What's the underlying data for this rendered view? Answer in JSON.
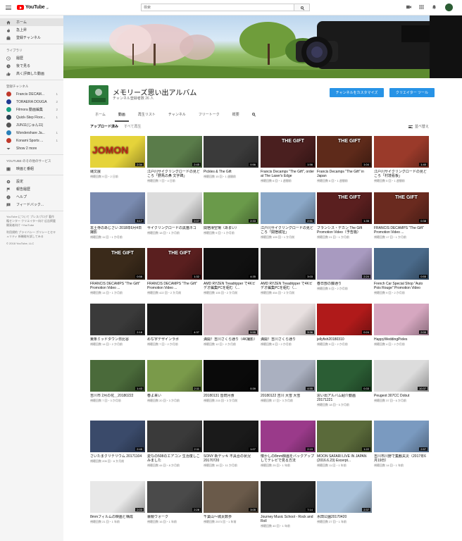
{
  "topbar": {
    "logo_text": "YouTube",
    "logo_region": "JP",
    "search_placeholder": "検索"
  },
  "sidebar": {
    "main": [
      {
        "label": "ホーム",
        "icon": "home-icon"
      },
      {
        "label": "急上昇",
        "icon": "trending-icon"
      },
      {
        "label": "登録チャンネル",
        "icon": "subscriptions-icon"
      }
    ],
    "library_heading": "ライブラリ",
    "library": [
      {
        "label": "履歴",
        "icon": "history-icon"
      },
      {
        "label": "後で見る",
        "icon": "watch-later-icon"
      },
      {
        "label": "高く評価した動画",
        "icon": "thumb-up-icon"
      }
    ],
    "subs_heading": "登録チャンネル",
    "subs": [
      {
        "label": "Francis DECAM...",
        "count": "1",
        "color": "#c0392b"
      },
      {
        "label": "TORAERA DOUGA",
        "count": "2",
        "color": "#1f3a93"
      },
      {
        "label": "Filmora 動画編集",
        "count": "2",
        "color": "#16a085"
      },
      {
        "label": "Quick-Step Floor...",
        "count": "1",
        "color": "#2c3e50"
      },
      {
        "label": "JUN11(じゅん11)",
        "count": "",
        "color": "#555555"
      },
      {
        "label": "Wondershare Ja...",
        "count": "1",
        "color": "#2980b9"
      },
      {
        "label": "Konami Sports ...",
        "count": "1",
        "color": "#c0392b"
      }
    ],
    "show_more": "Show 2 more",
    "services_heading": "YouTube のその他のサービス",
    "services": [
      {
        "label": "映画と番組",
        "icon": "movies-icon"
      }
    ],
    "settings": [
      {
        "label": "設定",
        "icon": "gear-icon"
      },
      {
        "label": "報告履歴",
        "icon": "flag-icon"
      },
      {
        "label": "ヘルプ",
        "icon": "help-icon"
      },
      {
        "label": "フィードバック...",
        "icon": "feedback-icon"
      }
    ],
    "footer1": "YouTube について プレス/ブログ 著作権センター クリエイター向け 広告掲載 開発者向け +YouTube",
    "footer2": "利用規約 プライバシー ポリシーとセキュリティ 新機能を試してみる",
    "copyright": "© 2018 YouTube, LLC"
  },
  "channel": {
    "title": "メモリーズ思い出アルバム",
    "subs": "チャンネル登録者数 26 人",
    "avatar_text": "思い出\nアルバ",
    "customize_button": "チャンネルをカスタマイズ",
    "creator_button": "クリエイター ツール",
    "tabs": [
      "ホーム",
      "動画",
      "再生リスト",
      "チャンネル",
      "フリートーク",
      "概要"
    ],
    "active_tab": 1
  },
  "sort": {
    "current": "アップロード済み",
    "alt": "すべて再生",
    "right": "並べ替え"
  },
  "videos": [
    {
      "title": "縄文展",
      "meta": "視聴回数 9 回・2 日前",
      "duration": "2:34",
      "color": "#e5d33a",
      "overlay": "JOMON"
    },
    {
      "title": "江戸川サイクリングロードの見どころ「野馬の鼻 文字碑」",
      "meta": "視聴回数 7 回・4 日前",
      "duration": "2:45",
      "color": "#5a7c4a",
      "overlay": ""
    },
    {
      "title": "Pickles & The Gift",
      "meta": "視聴回数 15 回・1 週間前",
      "duration": "0:56",
      "color": "#3a3a3a",
      "overlay": ""
    },
    {
      "title": "Francis Decamps \"The Gift\", order at The Laser's Edge",
      "meta": "視聴回数 6 回・1 週間前",
      "duration": "1:56",
      "color": "#4a1f1f",
      "overlay": "THE GIFT"
    },
    {
      "title": "Francis Decamps \"The Gift\" in Japan",
      "meta": "視聴回数 6 回・1 週間前",
      "duration": "1:04",
      "color": "#5e2a1a",
      "overlay": "THE GIFT"
    },
    {
      "title": "江戸川サイクリングロードの見どころ「村境看板」",
      "meta": "視聴回数 5 回・1 週間前",
      "duration": "1:40",
      "color": "#9a3a2a",
      "overlay": ""
    },
    {
      "title": "本土寺のあじさい 2018年6月4日 撮影",
      "meta": "視聴回数 11 回・1 か月前",
      "duration": "3:17",
      "color": "#7a8bb0",
      "overlay": ""
    },
    {
      "title": "サイクリングロードの黒猫ネコ",
      "meta": "視聴回数 18 回・1 か月前",
      "duration": "2:07",
      "color": "#dcdcdc",
      "overlay": ""
    },
    {
      "title": "関宿滑空場（あまい）",
      "meta": "視聴回数 9 回・1 か月前",
      "duration": "2:33",
      "color": "#6a9a4a",
      "overlay": ""
    },
    {
      "title": "江戸川サイクリングロードの見どころ「関宿城址」",
      "meta": "視聴回数 109 回・1 か月前",
      "duration": "2:51",
      "color": "#8aa7c7",
      "overlay": ""
    },
    {
      "title": "フランシス・デカン The Gift Promotion Video（予告篇）",
      "meta": "視聴回数 21 回・1 か月前",
      "duration": "1:35",
      "color": "#5a1f1f",
      "overlay": "THE GIFT"
    },
    {
      "title": "FRANCIS DECAMPS \"The Gift\" Promotion Video ...",
      "meta": "視聴回数 17 回・1 か月前",
      "duration": "0:38",
      "color": "#6a2a1f",
      "overlay": "THE GIFT"
    },
    {
      "title": "FRANCIS DECAMPS \"The Gift\" Promotion Video ...",
      "meta": "視聴回数 14 回・1 か月前",
      "duration": "0:58",
      "color": "#3a2a1a",
      "overlay": "THE GIFT"
    },
    {
      "title": "FRANCIS DECAMPS \"The Gift\" Promotion Video ...",
      "meta": "視聴回数 422 回・2 か月前",
      "duration": "1:32",
      "color": "#5a1f1f",
      "overlay": "THE GIFT"
    },
    {
      "title": "AMD RYZEN Treadripper で4Kビデオ編集PCを組む（...",
      "meta": "視聴回数 105 回・2 か月前",
      "duration": "4:35",
      "color": "#111111",
      "overlay": ""
    },
    {
      "title": "AMD RYZEN Treadripper で4Kビデオ編集PCを組む（...",
      "meta": "視聴回数 454 回・2 か月前",
      "duration": "3:03",
      "color": "#222222",
      "overlay": ""
    },
    {
      "title": "春日部の藤通り",
      "meta": "視聴回数 5 回・2 か月前",
      "duration": "2:24",
      "color": "#a89ac0",
      "overlay": ""
    },
    {
      "title": "French Car Special Shop \"Auto Pois Rouge\" Promotion Video",
      "meta": "視聴回数 9 回・2 か月前",
      "duration": "0:55",
      "color": "#4a6a8a",
      "overlay": ""
    },
    {
      "title": "東条ミッドタウン日比谷",
      "meta": "視聴回数 14 回・2 か月前",
      "duration": "2:18",
      "color": "#3a3a3a",
      "overlay": ""
    },
    {
      "title": "めぢ字デザインラボ",
      "meta": "視聴回数 7 回・2 か月前",
      "duration": "4:37",
      "color": "#1a1a1a",
      "overlay": ""
    },
    {
      "title": "満開！吉川さくら通り（4K撮影）",
      "meta": "視聴回数 12 回・2 か月前",
      "duration": "5:55",
      "color": "#d8c0c8",
      "overlay": ""
    },
    {
      "title": "満開！吉川さくら通り",
      "meta": "視聴回数 6 回・2 か月前",
      "duration": "3:36",
      "color": "#e8e0e0",
      "overlay": ""
    },
    {
      "title": "jellyfish20180310",
      "meta": "視聴回数 9 回・2 か月前",
      "duration": "0:24",
      "color": "#b01a1a",
      "overlay": ""
    },
    {
      "title": "HappyWeddingPixles",
      "meta": "視聴回数 4 回・2 か月前",
      "duration": "2:00",
      "color": "#d6a7c0",
      "overlay": ""
    },
    {
      "title": "吉川市 2月の花＿20180222",
      "meta": "視聴回数 7 回・3 か月前",
      "duration": "1:43",
      "color": "#4a6a3a",
      "overlay": ""
    },
    {
      "title": "春よ来い",
      "meta": "視聴回数 20 回・3 か月前",
      "duration": "2:11",
      "color": "#7a9a4a",
      "overlay": ""
    },
    {
      "title": "20180131 皆既月食",
      "meta": "視聴回数 215 回・3 か月前",
      "duration": "0:39",
      "color": "#0a0a0a",
      "overlay": ""
    },
    {
      "title": "20180122 吉川 大雪 大雪",
      "meta": "視聴回数 17 回・3 か月前",
      "duration": "4:55",
      "color": "#aab0c0",
      "overlay": ""
    },
    {
      "title": "思い出アルバム紹介動画 20171221",
      "meta": "視聴回数 18 回・5 か月前",
      "duration": "0:33",
      "color": "#2b5d34",
      "overlay": ""
    },
    {
      "title": "Peugeot 307CC Dobut",
      "meta": "視聴回数 37 回・6 か月前",
      "duration": "10:37",
      "color": "#dcdcdc",
      "overlay": ""
    },
    {
      "title": "さいたまクリテリウム 20171104",
      "meta": "視聴回数 205 回・6 か月前",
      "duration": "2:45",
      "color": "#3a4a6a",
      "overlay": ""
    },
    {
      "title": "愛なの508のエアコン 生活復しこみました",
      "meta": "視聴回数 44 回・8 か月前",
      "duration": "2:11",
      "color": "#3a3a3a",
      "overlay": ""
    },
    {
      "title": "SONY 新デッキ 不具合の状況 20170720",
      "meta": "視聴回数 16 回・11 か月前",
      "duration": "1:07",
      "color": "#1a1a1a",
      "overlay": ""
    },
    {
      "title": "懐かしの8mm映画をバックアップしてテレビで見る方法",
      "meta": "視聴回数 25 回・1 年前",
      "duration": "2:19",
      "color": "#9a3a8a",
      "overlay": ""
    },
    {
      "title": "MOON SAFARI LIVE IN JAPAN (2016.6.23) Excerpt...",
      "meta": "視聴回数 11 回・1 年前",
      "duration": "1:22",
      "color": "#5a6a3a",
      "overlay": ""
    },
    {
      "title": "吉川市川野で集観夫災（2017年6月19日）",
      "meta": "視聴回数 14 回・1 年前",
      "duration": "2:57",
      "color": "#7a9ac0",
      "overlay": ""
    },
    {
      "title": "8mmフィルムの映画と構成",
      "meta": "視聴回数 21 回・1 年前",
      "duration": "2:03",
      "color": "#e8e8e8",
      "overlay": ""
    },
    {
      "title": "暴競ウォーク",
      "meta": "視聴回数 16 回・1 年前",
      "duration": "2:28",
      "color": "#4a4a4a",
      "overlay": ""
    },
    {
      "title": "千葉山〜城太数歩",
      "meta": "視聴回数 2573 回・1 年前",
      "duration": "3:05",
      "color": "#6a5a4a",
      "overlay": ""
    },
    {
      "title": "Journey Music School - Rock and Roll",
      "meta": "視聴回数 40 回・1 年前",
      "duration": "7:14",
      "color": "#2a2a2a",
      "overlay": ""
    },
    {
      "title": "水田公園20170420",
      "meta": "視聴回数 27 回・1 年前",
      "duration": "2:37",
      "color": "#a8c0d8",
      "overlay": ""
    }
  ]
}
